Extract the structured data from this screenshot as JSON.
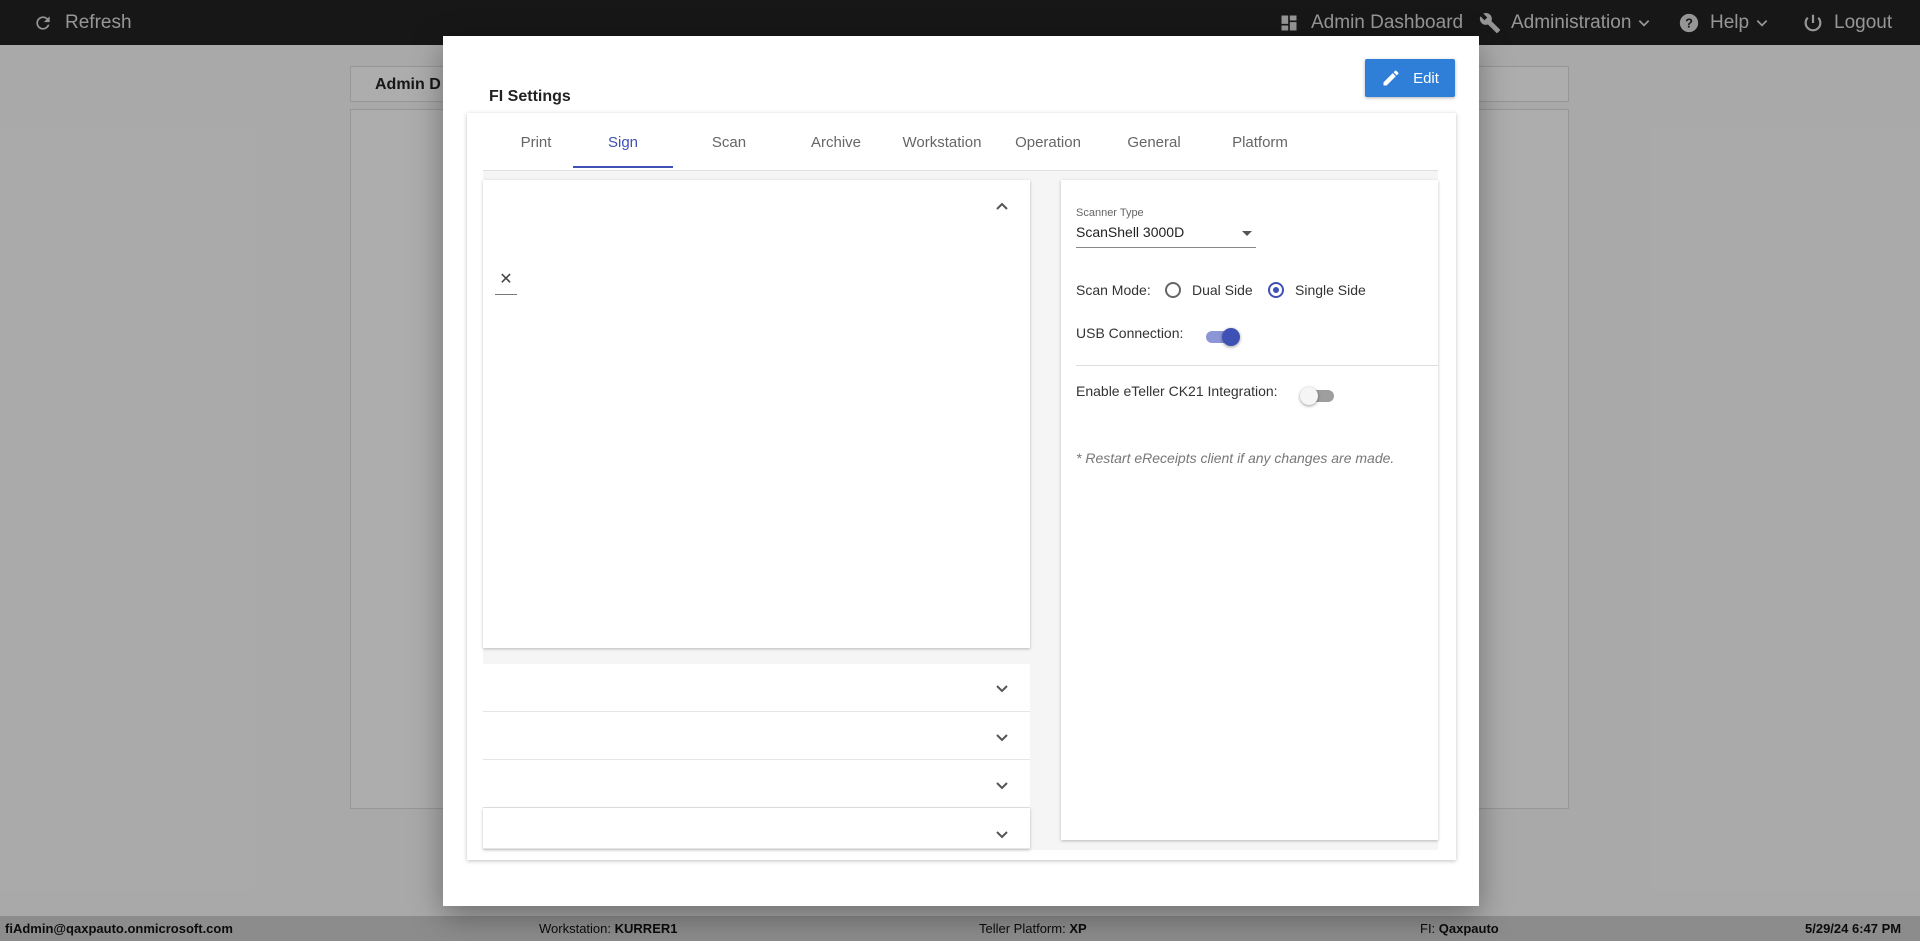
{
  "topbar": {
    "refresh": "Refresh",
    "admin_dashboard": "Admin Dashboard",
    "administration": "Administration",
    "help": "Help",
    "logout": "Logout"
  },
  "background": {
    "card_title": "Admin D"
  },
  "modal": {
    "title": "FI Settings",
    "edit_label": "Edit",
    "tabs": [
      "Print",
      "Sign",
      "Scan",
      "Archive",
      "Workstation",
      "Operation",
      "General",
      "Platform"
    ],
    "active_tab": "Sign",
    "left": {
      "clear_symbol": "✕"
    },
    "right": {
      "scanner_type_label": "Scanner Type",
      "scanner_type_value": "ScanShell 3000D",
      "scan_mode_label": "Scan Mode:",
      "dual_side": "Dual Side",
      "single_side": "Single Side",
      "scan_mode_selected": "Single Side",
      "usb_label": "USB Connection:",
      "usb_on": true,
      "eteller_label": "Enable eTeller CK21 Integration:",
      "eteller_on": false,
      "note": "* Restart eReceipts client if any changes are made."
    }
  },
  "statusbar": {
    "user": "fiAdmin@qaxpauto.onmicrosoft.com",
    "workstation_label": "Workstation:",
    "workstation_value": "KURRER1",
    "teller_label": "Teller Platform:",
    "teller_value": "XP",
    "fi_label": "FI:",
    "fi_value": "Qaxpauto",
    "datetime": "5/29/24 6:47 PM"
  },
  "colors": {
    "accent": "#3f51b5",
    "edit_button": "#2f7fd8",
    "topbar": "#222222"
  }
}
